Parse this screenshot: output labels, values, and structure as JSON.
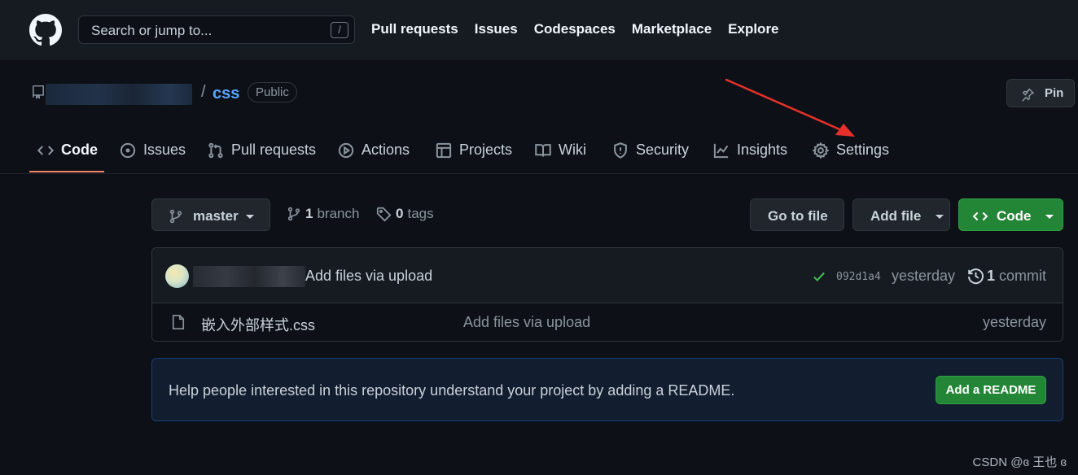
{
  "header": {
    "search_placeholder": "Search or jump to...",
    "search_shortcut": "/",
    "nav": [
      "Pull requests",
      "Issues",
      "Codespaces",
      "Marketplace",
      "Explore"
    ]
  },
  "repo": {
    "separator": "/",
    "name": "css",
    "visibility": "Public",
    "pin_label": "Pin"
  },
  "tabs": [
    {
      "label": "Code",
      "icon": "code-icon",
      "active": true
    },
    {
      "label": "Issues",
      "icon": "issue-opened-icon"
    },
    {
      "label": "Pull requests",
      "icon": "git-pull-request-icon"
    },
    {
      "label": "Actions",
      "icon": "play-icon"
    },
    {
      "label": "Projects",
      "icon": "table-icon"
    },
    {
      "label": "Wiki",
      "icon": "book-icon"
    },
    {
      "label": "Security",
      "icon": "shield-icon"
    },
    {
      "label": "Insights",
      "icon": "graph-icon"
    },
    {
      "label": "Settings",
      "icon": "gear-icon"
    }
  ],
  "branch_bar": {
    "branch": "master",
    "branch_count": "1",
    "branch_word": "branch",
    "tag_count": "0",
    "tag_word": "tags",
    "go_to_file": "Go to file",
    "add_file": "Add file",
    "code": "Code"
  },
  "latest_commit": {
    "message": "Add files via upload",
    "sha": "092d1a4",
    "time": "yesterday",
    "commit_count": "1",
    "commit_word": "commit"
  },
  "files": [
    {
      "name": "嵌入外部样式.css",
      "message": "Add files via upload",
      "time": "yesterday"
    }
  ],
  "readme_banner": {
    "text": "Help people interested in this repository understand your project by adding a README.",
    "button": "Add a README"
  },
  "watermark": "CSDN @ɞ 王也 ɞ",
  "colors": {
    "background": "#0d1117",
    "header": "#161b22",
    "link": "#58a6ff",
    "primary_button": "#238636",
    "active_tab_underline": "#f78166",
    "annotation_arrow": "#e8302a"
  }
}
